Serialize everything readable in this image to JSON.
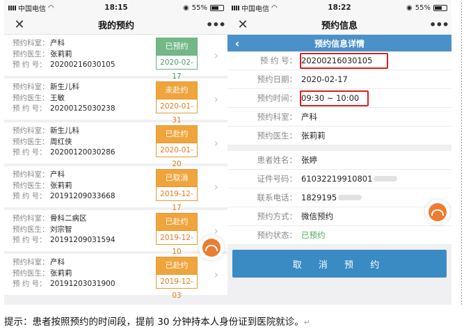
{
  "left": {
    "status": {
      "carrier": "中国电信",
      "time": "18:15",
      "battery": "55%"
    },
    "title": "我的预约",
    "close_icon": "close-icon",
    "more_icon": "more-icon",
    "labels": {
      "dept": "预约科室：",
      "doctor": "预约医生：",
      "no": "预 约 号："
    },
    "items": [
      {
        "dept": "产科",
        "doctor": "张莉莉",
        "no": "20200216030105",
        "status": "已预约",
        "date": "2020-02-17",
        "color": "green"
      },
      {
        "dept": "新生儿科",
        "doctor": "王敏",
        "no": "20200125030238",
        "status": "未赴约",
        "date": "2020-01-31",
        "color": "orange"
      },
      {
        "dept": "新生儿科",
        "doctor": "周红侠",
        "no": "20200120030286",
        "status": "已赴约",
        "date": "2020-01-20",
        "color": "orange"
      },
      {
        "dept": "产科",
        "doctor": "张莉莉",
        "no": "20191209033668",
        "status": "已取消",
        "date": "2019-12-17",
        "color": "orange"
      },
      {
        "dept": "骨科二病区",
        "doctor": "刘宗智",
        "no": "20191209031594",
        "status": "已赴约",
        "date": "2019-12-10",
        "color": "orange"
      },
      {
        "dept": "产科",
        "doctor": "张莉莉",
        "no": "20191203031900",
        "status": "已赴约",
        "date": "2019-12-03",
        "color": "orange"
      }
    ]
  },
  "right": {
    "status": {
      "carrier": "中国电信",
      "time": "18:22",
      "battery": "55%"
    },
    "title": "预约信息",
    "detail_title": "预约信息详情",
    "back_icon": "chevron-left-icon",
    "rows1": [
      {
        "label": "预 约 号：",
        "value": "20200216030105",
        "highlight": true
      },
      {
        "label": "预约日期：",
        "value": "2020-02-17",
        "highlight": false
      },
      {
        "label": "预约时间：",
        "value": "09:30 ~ 10:00",
        "highlight": true
      },
      {
        "label": "预约科室：",
        "value": "产科",
        "highlight": false
      },
      {
        "label": "预约医生：",
        "value": "张莉莉",
        "highlight": false
      }
    ],
    "rows2": [
      {
        "label": "患者姓名：",
        "value": "张婷",
        "blur": false
      },
      {
        "label": "证件号码：",
        "value": "61032219910801",
        "blur": true
      },
      {
        "label": "联系电话：",
        "value": "1829195",
        "blur": true
      },
      {
        "label": "预约方式：",
        "value": "微信预约",
        "blur": false
      },
      {
        "label": "预约状态：",
        "value": "已预约",
        "blur": false,
        "green": true
      }
    ],
    "cancel_label": "取 消 预 约"
  },
  "tip": "提示：患者按照预约的时间段，提前 30 分钟持本人身份证到医院就诊。",
  "tip_mark": "↵",
  "colors": {
    "accent": "#4a90c9",
    "badge_orange": "#f0a43c",
    "badge_green": "#74b888",
    "highlight": "#d81e1e"
  }
}
